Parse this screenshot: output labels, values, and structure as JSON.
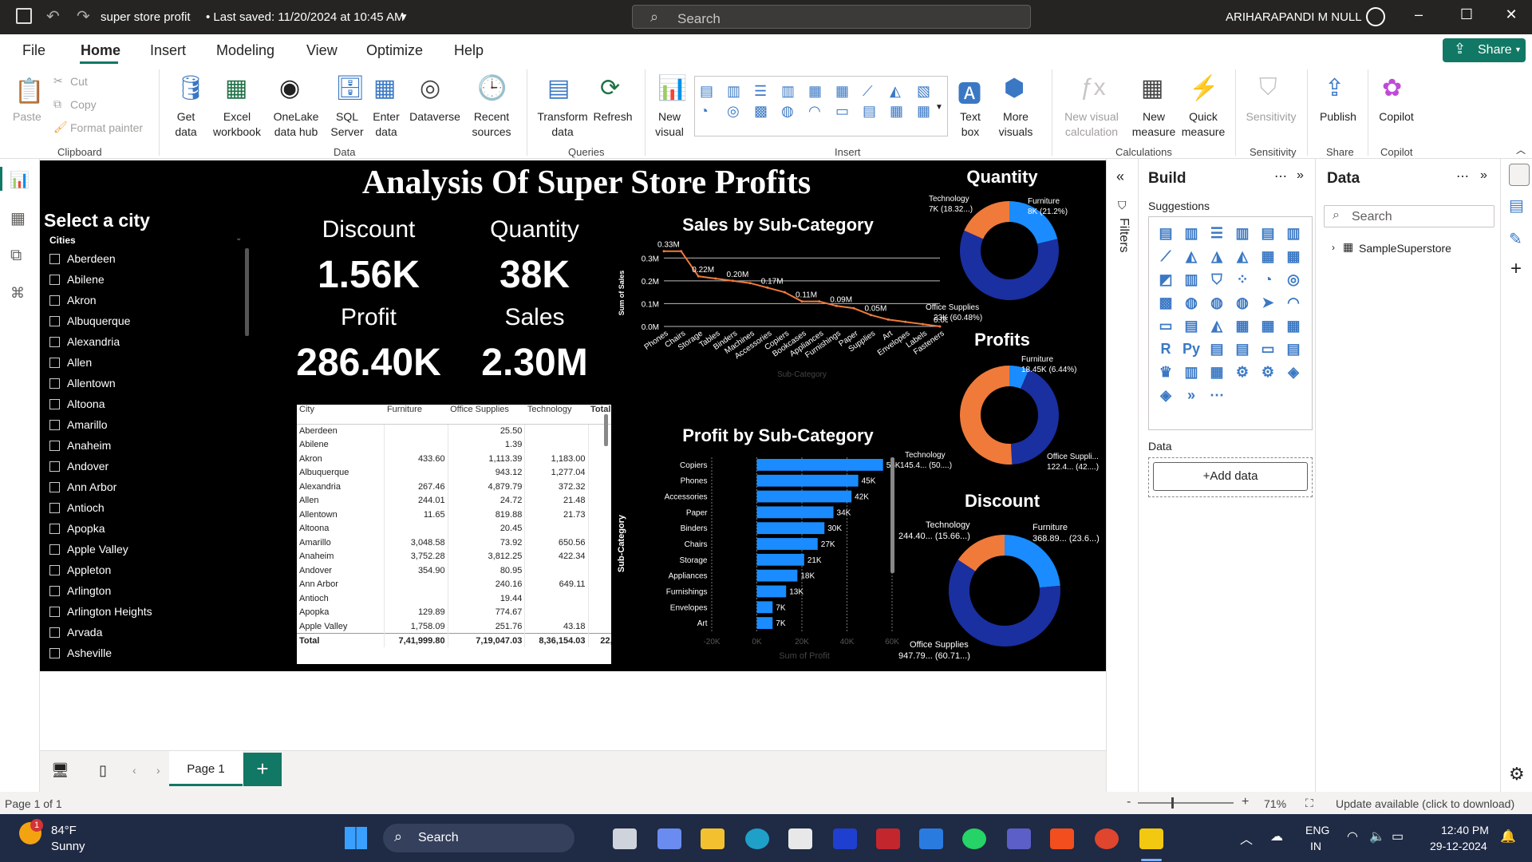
{
  "titlebar": {
    "doc_title": "super store profit",
    "saved_status": "• Last saved: 11/20/2024 at 10:45 AM",
    "search_placeholder": "Search",
    "user": "ARIHARAPANDI M NULL"
  },
  "menu": [
    "File",
    "Home",
    "Insert",
    "Modeling",
    "View",
    "Optimize",
    "Help"
  ],
  "share_label": "Share",
  "ribbon": {
    "clipboard": {
      "paste": "Paste",
      "cut": "Cut",
      "copy": "Copy",
      "format_painter": "Format painter",
      "group": "Clipboard"
    },
    "data": {
      "get_data": "Get data",
      "excel": "Excel workbook",
      "onelake": "OneLake data hub",
      "sql": "SQL Server",
      "enter": "Enter data",
      "dataverse": "Dataverse",
      "recent": "Recent sources",
      "group": "Data"
    },
    "queries": {
      "transform": "Transform data",
      "refresh": "Refresh",
      "group": "Queries"
    },
    "insert": {
      "new_visual": "New visual",
      "text_box": "Text box",
      "more_visuals": "More visuals",
      "group": "Insert"
    },
    "calculations": {
      "new_visual_calc": "New visual calculation",
      "new_measure": "New measure",
      "quick_measure": "Quick measure",
      "group": "Calculations"
    },
    "sensitivity": {
      "label": "Sensitivity",
      "group": "Sensitivity"
    },
    "share": {
      "publish": "Publish",
      "group": "Share"
    },
    "copilot": {
      "label": "Copilot",
      "group": "Copilot"
    }
  },
  "report": {
    "title": "Analysis Of Super Store Profits",
    "slicer": {
      "title": "Select a city",
      "field": "Cities",
      "cities": [
        "Aberdeen",
        "Abilene",
        "Akron",
        "Albuquerque",
        "Alexandria",
        "Allen",
        "Allentown",
        "Altoona",
        "Amarillo",
        "Anaheim",
        "Andover",
        "Ann Arbor",
        "Antioch",
        "Apopka",
        "Apple Valley",
        "Appleton",
        "Arlington",
        "Arlington Heights",
        "Arvada",
        "Asheville"
      ]
    },
    "kpis": {
      "discount_label": "Discount",
      "discount_value": "1.56K",
      "quantity_label": "Quantity",
      "quantity_value": "38K",
      "profit_label": "Profit",
      "profit_value": "286.40K",
      "sales_label": "Sales",
      "sales_value": "2.30M"
    },
    "table": {
      "headers": [
        "City",
        "Furniture",
        "Office Supplies",
        "Technology",
        "Total"
      ],
      "rows": [
        [
          "Aberdeen",
          "",
          "25.50",
          "",
          ""
        ],
        [
          "Abilene",
          "",
          "1.39",
          "",
          ""
        ],
        [
          "Akron",
          "433.60",
          "1,113.39",
          "1,183.00",
          "2,7"
        ],
        [
          "Albuquerque",
          "",
          "943.12",
          "1,277.04",
          "2,2"
        ],
        [
          "Alexandria",
          "267.46",
          "4,879.79",
          "372.32",
          "5,5"
        ],
        [
          "Allen",
          "244.01",
          "24.72",
          "21.48",
          "2"
        ],
        [
          "Allentown",
          "11.65",
          "819.88",
          "21.73",
          "8"
        ],
        [
          "Altoona",
          "",
          "20.45",
          "",
          ""
        ],
        [
          "Amarillo",
          "3,048.58",
          "73.92",
          "650.56",
          "3,7"
        ],
        [
          "Anaheim",
          "3,752.28",
          "3,812.25",
          "422.34",
          "7,9"
        ],
        [
          "Andover",
          "354.90",
          "80.95",
          "",
          "4"
        ],
        [
          "Ann Arbor",
          "",
          "240.16",
          "649.11",
          "8"
        ],
        [
          "Antioch",
          "",
          "19.44",
          "",
          ""
        ],
        [
          "Apopka",
          "129.89",
          "774.67",
          "",
          "9"
        ],
        [
          "Apple Valley",
          "1,758.09",
          "251.76",
          "43.18",
          "2,0"
        ]
      ],
      "total": [
        "Total",
        "7,41,999.80",
        "7,19,047.03",
        "8,36,154.03",
        "22,97,2"
      ]
    },
    "sales_chart_title": "Sales by Sub-Category",
    "profit_chart_title": "Profit by Sub-Category",
    "quantity_donut": {
      "title": "Quantity",
      "labels": [
        "Technology",
        "7K (18.32...)",
        "Furniture",
        "8K (21.2%)",
        "Office Supplies",
        "23K (60.48%)"
      ]
    },
    "profits_donut": {
      "title": "Profits",
      "labels": [
        "Furniture",
        "18.45K (6.44%)",
        "Technology",
        "145.4... (50....)",
        "Office Suppli...",
        "122.4... (42....)"
      ]
    },
    "discount_donut": {
      "title": "Discount",
      "labels": [
        "Technology",
        "244.40... (15.66...)",
        "Furniture",
        "368.89... (23.6...)",
        "Office Supplies",
        "947.79... (60.71...)"
      ]
    }
  },
  "chart_data": [
    {
      "type": "line",
      "title": "Sales by Sub-Category",
      "xlabel": "Sub-Category",
      "ylabel": "Sum of Sales",
      "categories": [
        "Phones",
        "Chairs",
        "Storage",
        "Tables",
        "Binders",
        "Machines",
        "Accessories",
        "Copiers",
        "Bookcases",
        "Appliances",
        "Furnishings",
        "Paper",
        "Supplies",
        "Art",
        "Envelopes",
        "Labels",
        "Fasteners"
      ],
      "values": [
        0.33,
        0.33,
        0.22,
        0.21,
        0.2,
        0.19,
        0.17,
        0.15,
        0.11,
        0.11,
        0.09,
        0.08,
        0.05,
        0.03,
        0.02,
        0.01,
        0.0
      ],
      "data_labels": [
        "0.33M",
        "",
        "0.22M",
        "",
        "0.20M",
        "",
        "0.17M",
        "",
        "0.11M",
        "",
        "0.09M",
        "",
        "0.05M",
        "",
        "",
        "",
        "0.00M"
      ],
      "yticks": [
        "0.0M",
        "0.1M",
        "0.2M",
        "0.3M"
      ],
      "unit": "M",
      "ylim": [
        0,
        0.35
      ],
      "color": "#f07a3a"
    },
    {
      "type": "bar",
      "orientation": "horizontal",
      "title": "Profit by Sub-Category",
      "xlabel": "Sum of Profit",
      "ylabel": "Sub-Category",
      "categories": [
        "Copiers",
        "Phones",
        "Accessories",
        "Paper",
        "Binders",
        "Chairs",
        "Storage",
        "Appliances",
        "Furnishings",
        "Envelopes",
        "Art"
      ],
      "values": [
        56,
        45,
        42,
        34,
        30,
        27,
        21,
        18,
        13,
        7,
        7
      ],
      "data_labels": [
        "56K",
        "45K",
        "42K",
        "34K",
        "30K",
        "27K",
        "21K",
        "18K",
        "13K",
        "7K",
        "7K"
      ],
      "xticks": [
        "-20K",
        "0K",
        "20K",
        "40K",
        "60K"
      ],
      "xlim": [
        -20,
        60
      ],
      "unit": "K",
      "color": "#1a8cff"
    },
    {
      "type": "pie",
      "title": "Quantity",
      "categories": [
        "Furniture",
        "Office Supplies",
        "Technology"
      ],
      "values": [
        21.2,
        60.48,
        18.32
      ],
      "colors": [
        "#1a8cff",
        "#1a2fa0",
        "#f07a3a"
      ]
    },
    {
      "type": "pie",
      "title": "Profits",
      "categories": [
        "Furniture",
        "Office Supplies",
        "Technology"
      ],
      "values": [
        6.44,
        42.7,
        50.86
      ],
      "colors": [
        "#1a8cff",
        "#1a2fa0",
        "#f07a3a"
      ]
    },
    {
      "type": "pie",
      "title": "Discount",
      "categories": [
        "Furniture",
        "Office Supplies",
        "Technology"
      ],
      "values": [
        23.6,
        60.71,
        15.66
      ],
      "colors": [
        "#1a8cff",
        "#1a2fa0",
        "#f07a3a"
      ]
    }
  ],
  "filters_label": "Filters",
  "build": {
    "title": "Build",
    "suggestions": "Suggestions",
    "data_label": "Data",
    "add_data": "+Add data"
  },
  "data_pane": {
    "title": "Data",
    "search_placeholder": "Search",
    "table": "SampleSuperstore"
  },
  "pages": {
    "page1": "Page 1",
    "add": "+"
  },
  "status": {
    "page": "Page 1 of 1",
    "zoom": "71%",
    "update": "Update available (click to download)"
  },
  "taskbar": {
    "temp": "84°F",
    "weather": "Sunny",
    "search": "Search",
    "lang1": "ENG",
    "lang2": "IN",
    "time": "12:40 PM",
    "date": "29-12-2024",
    "notify_count": "1"
  }
}
